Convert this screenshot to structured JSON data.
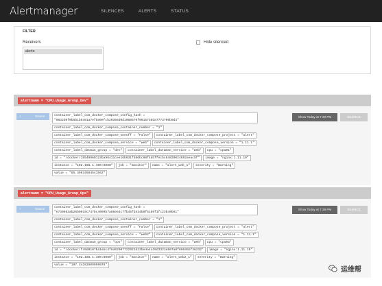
{
  "navbar": {
    "brand": "Alertmanager",
    "links": [
      "SILENCES",
      "ALERTS",
      "STATUS"
    ]
  },
  "filter": {
    "title": "FILTER",
    "receivers_label": "Receivers",
    "selected_receiver": "alerts",
    "hide_silenced_label": "Hide silenced",
    "hide_silenced_checked": false
  },
  "groups": [
    {
      "badge": "alertname = \"CPU_Usage_Group_Dev\"",
      "source_label": "Source",
      "show_label": "Show Today at 7:30 PM",
      "silence_label": "SILENCE",
      "label_rows": [
        [
          "container_label_com_docker_compose_config_hash = \"0832d0f0b5b1b5481a7ef5a0efcb20356d0d1088570f96157S5da7773706b0d3\""
        ],
        [
          "container_label_com_docker_compose_container_number = \"1\""
        ],
        [
          "container_label_com_docker_compose_oneoff = \"False\"",
          "container_label_com_docker_compose_project = \"alert\""
        ],
        [
          "container_label_com_docker_compose_service = \"web\"",
          "container_label_com_docker_compose_version = \"1.11.1\""
        ],
        [
          "container_label_datman_group = \"dev\"",
          "container_label_dataman_service = \"web\"",
          "cpu = \"cpu01\""
        ],
        [
          "id = \"/docker/15549960123ba96411cee16b031fd66bc98f4dbffec5c64820024692aeac5f\"",
          "image = \"nginx:1.11.10\""
        ],
        [
          "instance = \"192.168.1.100:8080\"",
          "job = \"monitor\"",
          "name = \"alert_web_1\"",
          "severity = \"Warning\""
        ],
        [
          "value = \"85.39634584541562\""
        ]
      ]
    },
    {
      "badge": "alertname = \"CPU_Usage_Group_Ops\"",
      "source_label": "Source",
      "show_label": "Show Today at 7:29 PM",
      "silence_label": "SILENCE",
      "label_rows": [
        [
          "container_label_com_docker_compose_config_hash = \"e730693ab26b0019c747bc4099b7a86e54c7fb45fd434b0f5169f1fc23b40b61\""
        ],
        [
          "container_label_com_docker_compose_container_number = \"1\""
        ],
        [
          "container_label_com_docker_compose_oneoff = \"False\"",
          "container_label_com_docker_compose_project = \"alert\""
        ],
        [
          "container_label_com_docker_compose_service = \"web2\"",
          "container_label_com_docker_compose_version = \"1.11.1\""
        ],
        [
          "container_label_datman_group = \"ops\"",
          "container_label_dataman_service = \"web\"",
          "cpu = \"cpu03\""
        ],
        [
          "id = \"/docker/f49d0107ba1ebc4f6462007722922d23be4a4430d3323a507a0f89645bf36232\"",
          "image = \"nginx:1.11.10\""
        ],
        [
          "instance = \"192.168.1.100:8080\"",
          "job = \"monitor\"",
          "name = \"alert_web2_1\"",
          "severity = \"Warning\""
        ],
        [
          "value = \"107.34282609999978\""
        ]
      ]
    }
  ],
  "watermark": {
    "text": "运维帮",
    "icon": "wechat-icon"
  }
}
